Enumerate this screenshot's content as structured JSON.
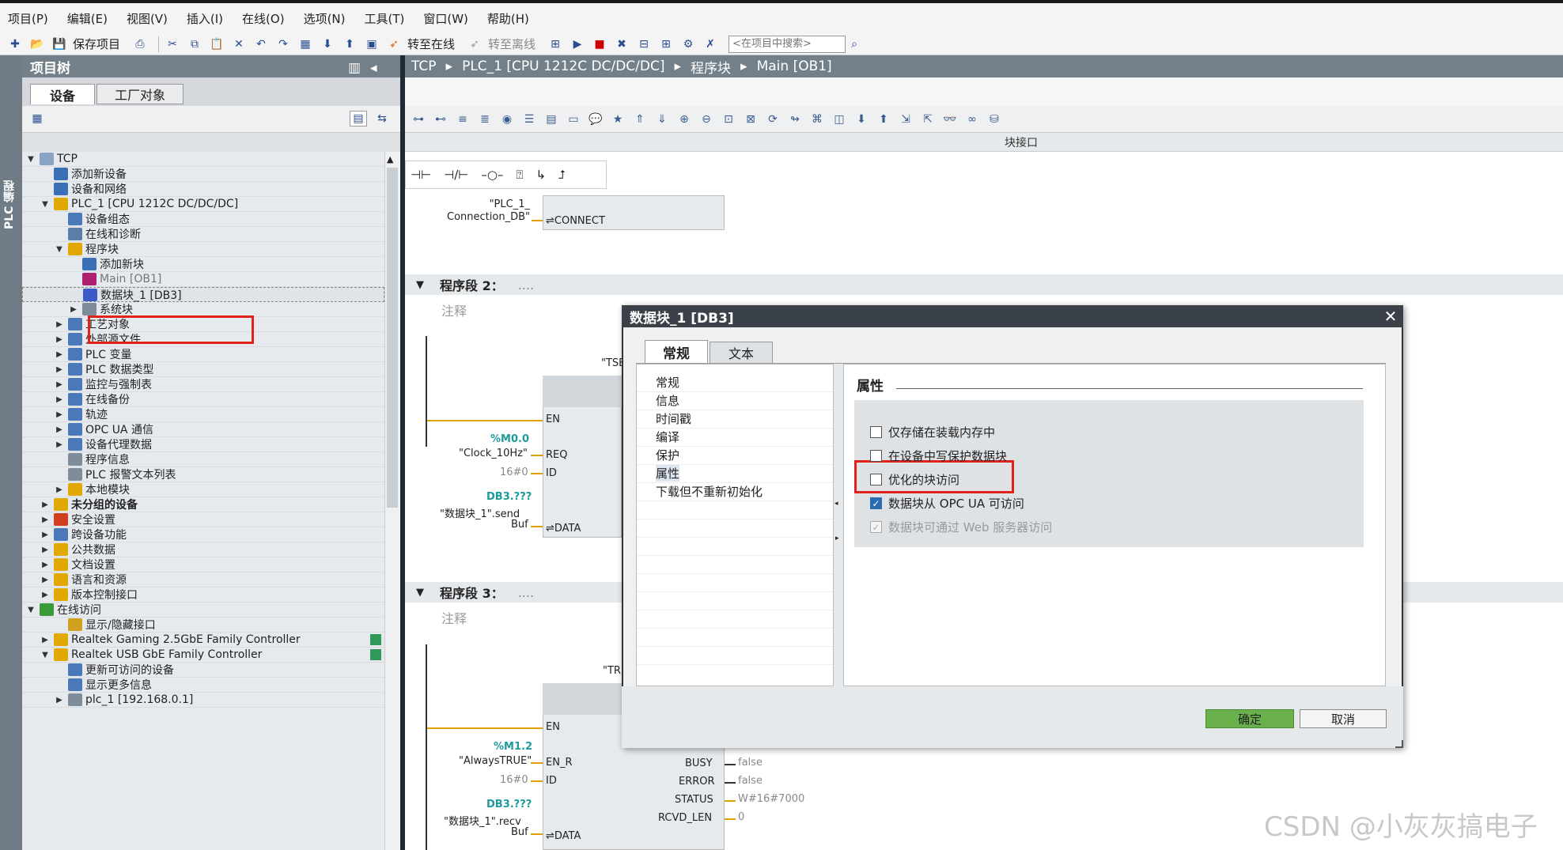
{
  "menu": [
    "项目(P)",
    "编辑(E)",
    "视图(V)",
    "插入(I)",
    "在线(O)",
    "选项(N)",
    "工具(T)",
    "窗口(W)",
    "帮助(H)"
  ],
  "toolbar": {
    "save_label": "保存项目",
    "go_online": "转至在线",
    "go_offline": "转至离线",
    "search_placeholder": "<在项目中搜索>"
  },
  "side_strip_label": "PLC 编程",
  "tree": {
    "title": "项目树",
    "tab_devices": "设备",
    "tab_plant": "工厂对象",
    "rows": [
      {
        "label": "TCP",
        "twisty": "▼",
        "indent": 0
      },
      {
        "label": "添加新设备",
        "twisty": "",
        "indent": 1
      },
      {
        "label": "设备和网络",
        "twisty": "",
        "indent": 1
      },
      {
        "label": "PLC_1 [CPU 1212C DC/DC/DC]",
        "twisty": "▼",
        "indent": 1
      },
      {
        "label": "设备组态",
        "twisty": "",
        "indent": 2
      },
      {
        "label": "在线和诊断",
        "twisty": "",
        "indent": 2
      },
      {
        "label": "程序块",
        "twisty": "▼",
        "indent": 2
      },
      {
        "label": "添加新块",
        "twisty": "",
        "indent": 3
      },
      {
        "label": "Main [OB1]",
        "twisty": "",
        "indent": 3
      },
      {
        "label": "数据块_1 [DB3]",
        "twisty": "",
        "indent": 3
      },
      {
        "label": "系统块",
        "twisty": "▶",
        "indent": 3
      },
      {
        "label": "工艺对象",
        "twisty": "▶",
        "indent": 2
      },
      {
        "label": "外部源文件",
        "twisty": "▶",
        "indent": 2
      },
      {
        "label": "PLC 变量",
        "twisty": "▶",
        "indent": 2
      },
      {
        "label": "PLC 数据类型",
        "twisty": "▶",
        "indent": 2
      },
      {
        "label": "监控与强制表",
        "twisty": "▶",
        "indent": 2
      },
      {
        "label": "在线备份",
        "twisty": "▶",
        "indent": 2
      },
      {
        "label": "轨迹",
        "twisty": "▶",
        "indent": 2
      },
      {
        "label": "OPC UA 通信",
        "twisty": "▶",
        "indent": 2
      },
      {
        "label": "设备代理数据",
        "twisty": "▶",
        "indent": 2
      },
      {
        "label": "程序信息",
        "twisty": "",
        "indent": 2
      },
      {
        "label": "PLC 报警文本列表",
        "twisty": "",
        "indent": 2
      },
      {
        "label": "本地模块",
        "twisty": "▶",
        "indent": 2
      },
      {
        "label": "未分组的设备",
        "twisty": "▶",
        "indent": 1
      },
      {
        "label": "安全设置",
        "twisty": "▶",
        "indent": 1
      },
      {
        "label": "跨设备功能",
        "twisty": "▶",
        "indent": 1
      },
      {
        "label": "公共数据",
        "twisty": "▶",
        "indent": 1
      },
      {
        "label": "文档设置",
        "twisty": "▶",
        "indent": 1
      },
      {
        "label": "语言和资源",
        "twisty": "▶",
        "indent": 1
      },
      {
        "label": "版本控制接口",
        "twisty": "▶",
        "indent": 1
      },
      {
        "label": "在线访问",
        "twisty": "▼",
        "indent": 0
      },
      {
        "label": "显示/隐藏接口",
        "twisty": "",
        "indent": 2
      },
      {
        "label": "Realtek Gaming 2.5GbE Family Controller",
        "twisty": "▶",
        "indent": 1
      },
      {
        "label": "Realtek USB GbE Family Controller",
        "twisty": "▼",
        "indent": 1
      },
      {
        "label": "更新可访问的设备",
        "twisty": "",
        "indent": 2
      },
      {
        "label": "显示更多信息",
        "twisty": "",
        "indent": 2
      },
      {
        "label": "plc_1 [192.168.0.1]",
        "twisty": "▶",
        "indent": 2
      }
    ]
  },
  "breadcrumb": [
    "TCP",
    "▸",
    "PLC_1 [CPU 1212C DC/DC/DC]",
    "▸",
    "程序块",
    "▸",
    "Main [OB1]"
  ],
  "block_interface_label": "块接口",
  "editor": {
    "connect_label": "\"PLC_1_\nConnection_DB\"",
    "connect_pin": "⇌CONNECT",
    "seg2": "程序段 2：",
    "seg3": "程序段 3：",
    "note": "注释",
    "dots": "....",
    "seg2_block_name": "\"TSE",
    "seg3_block_name": "\"TR",
    "pins": {
      "en": "EN",
      "req": "REQ",
      "id": "ID",
      "data": "⇌DATA",
      "en_r": "EN_R",
      "busy": "BUSY",
      "error": "ERROR",
      "status": "STATUS",
      "rcvd_len": "RCVD_LEN"
    },
    "seg2_vals": {
      "m_addr": "%M0.0",
      "m_name": "\"Clock_10Hz\"",
      "id_val": "16#0",
      "db_addr": "DB3.???",
      "db_name": "\"数据块_1\".send",
      "buf": "Buf"
    },
    "seg3_vals": {
      "m_addr": "%M1.2",
      "m_name": "\"AlwaysTRUE\"",
      "id_val": "16#0",
      "db_addr": "DB3.???",
      "db_name": "\"数据块_1\".recv",
      "buf": "Buf",
      "busy_val": "false",
      "error_val": "false",
      "status_val": "W#16#7000",
      "len_val": "0"
    }
  },
  "dialog": {
    "title": "数据块_1 [DB3]",
    "tab_general": "常规",
    "tab_text": "文本",
    "nav": [
      "常规",
      "信息",
      "时间戳",
      "编译",
      "保护",
      "属性",
      "下载但不重新初始化"
    ],
    "section_title": "属性",
    "options": [
      {
        "label": "仅存储在装载内存中",
        "state": "off"
      },
      {
        "label": "在设备中写保护数据块",
        "state": "off"
      },
      {
        "label": "优化的块访问",
        "state": "off"
      },
      {
        "label": "数据块从 OPC UA 可访问",
        "state": "on"
      },
      {
        "label": "数据块可通过 Web 服务器访问",
        "state": "disabled"
      }
    ],
    "ok": "确定",
    "cancel": "取消"
  },
  "watermark": "CSDN @小灰灰搞电子",
  "colors": {
    "highlight": "#e0221b",
    "ok_button": "#6ab04c",
    "header_gray": "#73808a",
    "teal": "#1d9a9a"
  }
}
